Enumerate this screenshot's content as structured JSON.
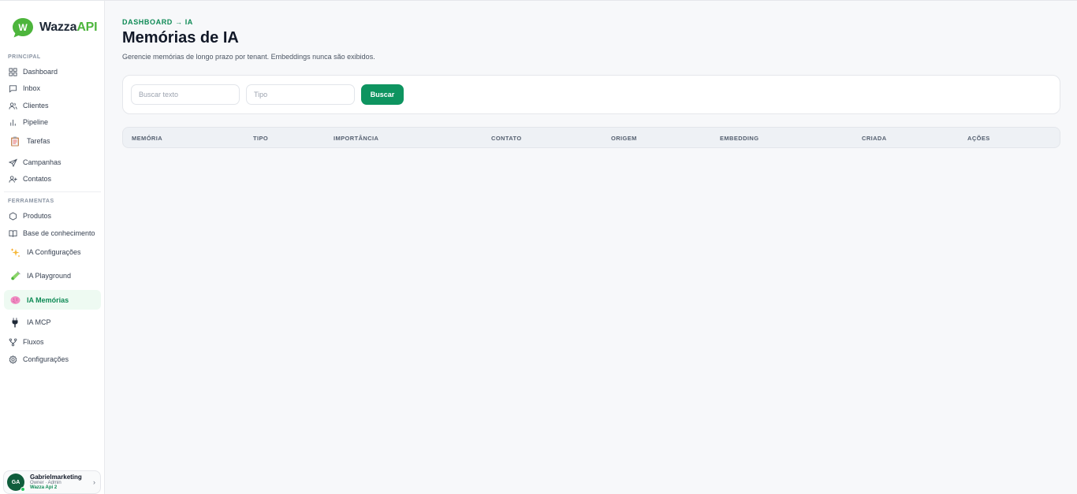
{
  "brand": {
    "name_main": "Wazza",
    "name_accent": "API",
    "colors": {
      "green": "#4db53c",
      "accent": "#0e9460"
    }
  },
  "sidebar": {
    "sections": [
      {
        "label": "PRINCIPAL"
      },
      {
        "label": "FERRAMENTAS"
      }
    ],
    "items": [
      {
        "label": "Dashboard",
        "icon": "grid-icon"
      },
      {
        "label": "Inbox",
        "icon": "chat-icon"
      },
      {
        "label": "Clientes",
        "icon": "users-icon"
      },
      {
        "label": "Pipeline",
        "icon": "bar-chart-icon"
      },
      {
        "label": "Tarefas",
        "icon": "clipboard-icon"
      },
      {
        "label": "Campanhas",
        "icon": "send-icon"
      },
      {
        "label": "Contatos",
        "icon": "user-plus-icon"
      },
      {
        "label": "Produtos",
        "icon": "hexagon-icon"
      },
      {
        "label": "Base de conhecimento",
        "icon": "book-icon"
      },
      {
        "label": "IA Configurações",
        "icon": "sparkles-icon"
      },
      {
        "label": "IA Playground",
        "icon": "test-tube-icon"
      },
      {
        "label": "IA Memórias",
        "icon": "brain-icon",
        "active": true
      },
      {
        "label": "IA MCP",
        "icon": "plug-icon"
      },
      {
        "label": "Fluxos",
        "icon": "flow-icon"
      },
      {
        "label": "Configurações",
        "icon": "gear-icon"
      }
    ]
  },
  "user": {
    "initials": "GA",
    "name": "Gabrielmarketing",
    "role": "Owner · Admin",
    "org": "Wazza Api 2"
  },
  "header": {
    "breadcrumb": "DASHBOARD → IA",
    "title": "Memórias de IA",
    "subtitle": "Gerencie memórias de longo prazo por tenant. Embeddings nunca são exibidos."
  },
  "filters": {
    "text_placeholder": "Buscar texto",
    "type_placeholder": "Tipo",
    "search_label": "Buscar"
  },
  "table": {
    "columns": [
      "MEMÓRIA",
      "TIPO",
      "IMPORTÂNCIA",
      "CONTATO",
      "ORIGEM",
      "EMBEDDING",
      "CRIADA",
      "AÇÕES"
    ],
    "rows": []
  }
}
